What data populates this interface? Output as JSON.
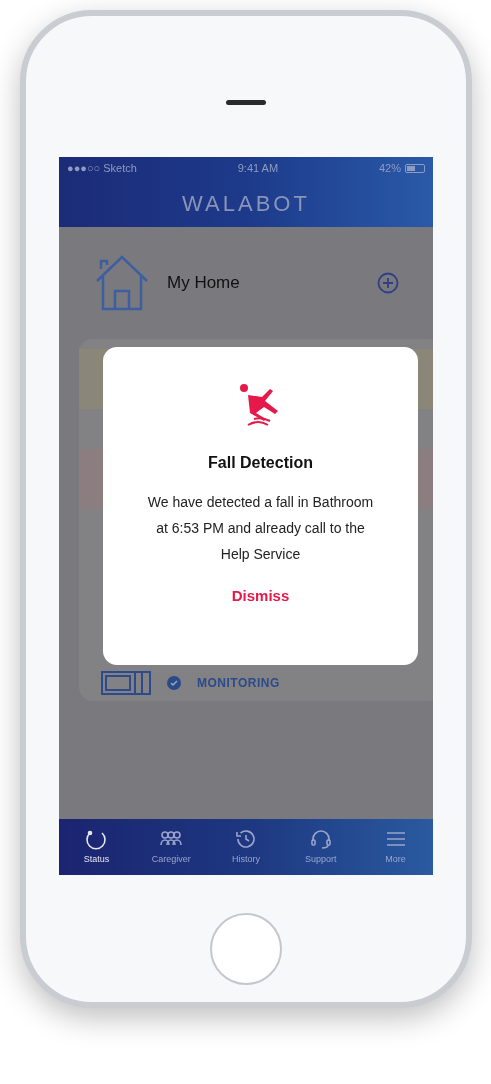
{
  "status_bar": {
    "carrier": "●●●○○ Sketch",
    "time": "9:41 AM",
    "battery": "42%"
  },
  "nav_bar": {
    "title": "WALABOT"
  },
  "home": {
    "title": "My Home"
  },
  "device": {
    "status": "MONITORING"
  },
  "alert": {
    "title": "Fall Detection",
    "message": "We have detected a fall in Bathroom at 6:53 PM and already call to the Help Service",
    "action": "Dismiss"
  },
  "tabs": [
    {
      "label": "Status",
      "kind": "status",
      "selected": true
    },
    {
      "label": "Caregiver",
      "kind": "caregiver",
      "selected": false
    },
    {
      "label": "History",
      "kind": "history",
      "selected": false
    },
    {
      "label": "Support",
      "kind": "support",
      "selected": false
    },
    {
      "label": "More",
      "kind": "more",
      "selected": false
    }
  ]
}
